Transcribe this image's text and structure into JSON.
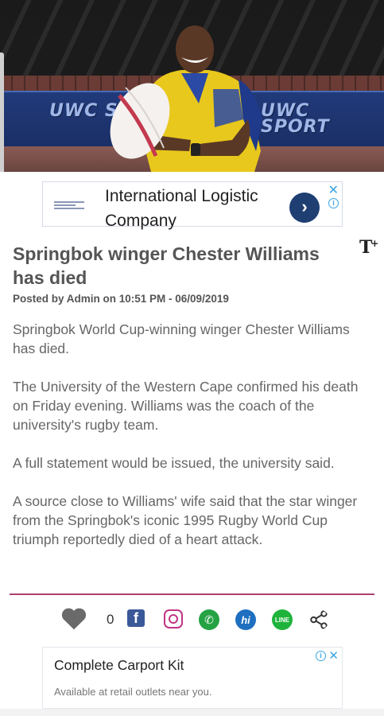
{
  "hero": {
    "banner_left_text": "UWC SPORT",
    "banner_right_text": "UWC SPORT"
  },
  "ad_top": {
    "title": "International Logistic Company",
    "close_glyph": "✕",
    "info_glyph": "i",
    "arrow_glyph": "›"
  },
  "article": {
    "headline": "Springbok winger Chester Williams has died",
    "font_toggle": "T",
    "font_toggle_plus": "+",
    "byline": "Posted by Admin on 10:51 PM - 06/09/2019",
    "paragraphs": [
      "Springbok World Cup-winning winger Chester Williams has died.",
      "The University of the Western Cape confirmed his death on Friday evening. Williams was the coach of the university's rugby team.",
      "A full statement would be issued, the university said.",
      "A source close to Williams' wife said that the star winger from the Springbok's iconic 1995 Rugby World Cup triumph reportedly died of a heart attack."
    ]
  },
  "share_bar": {
    "like_count": "0",
    "facebook_glyph": "f",
    "whatsapp_glyph": "✆",
    "hike_glyph": "hi",
    "line_glyph": "LINE",
    "icons": [
      "heart-icon",
      "facebook-icon",
      "instagram-icon",
      "whatsapp-icon",
      "hike-icon",
      "line-icon",
      "share-icon"
    ]
  },
  "ad_bottom": {
    "title": "Complete Carport Kit",
    "subtitle": "Available at retail outlets near you.",
    "close_glyph": "✕",
    "info_glyph": "i"
  },
  "colors": {
    "divider": "#b0406e",
    "facebook": "#3b5998",
    "instagram": "#c13584",
    "whatsapp": "#25a244",
    "hike": "#1f6fc0",
    "line": "#1fb33c",
    "ad_accent": "#3ba5e0"
  }
}
